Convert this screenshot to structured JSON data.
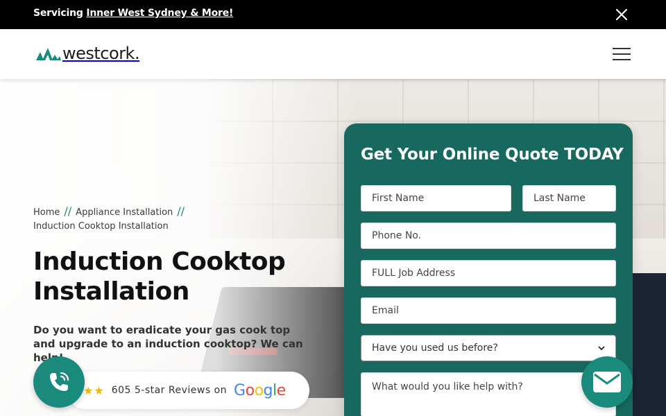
{
  "topbar": {
    "prefix": "Servicing ",
    "link_text": "Inner West Sydney & More!"
  },
  "header": {
    "logo_text": "westcork."
  },
  "breadcrumb": {
    "items": [
      "Home",
      "Appliance Installation",
      "Induction Cooktop Installation"
    ],
    "separator": "//"
  },
  "hero": {
    "title": "Induction Cooktop Installation",
    "lede": "Do you want to eradicate your gas cook top and upgrade to an induction cooktop? We can help!"
  },
  "reviews": {
    "stars": "★★",
    "text": "605 5-star Reviews on",
    "google_letters": [
      "G",
      "o",
      "o",
      "g",
      "l",
      "e"
    ]
  },
  "quote_form": {
    "heading": "Get Your Online Quote TODAY",
    "first_name_placeholder": "First Name",
    "last_name_placeholder": "Last Name",
    "phone_placeholder": "Phone No.",
    "address_placeholder": "FULL Job Address",
    "email_placeholder": "Email",
    "used_before_selected": "Have you used us before?",
    "help_placeholder": "What would you like help with?"
  },
  "colors": {
    "brand_teal": "#1a8a7d",
    "form_bg": "#17695f",
    "topbar_bg": "#000000",
    "google": [
      "#4285F4",
      "#EA4335",
      "#FBBC05",
      "#4285F4",
      "#34A853",
      "#EA4335"
    ]
  },
  "icons": {
    "close": "close-icon",
    "menu": "hamburger-menu-icon",
    "phone": "phone-icon",
    "mail": "mail-icon",
    "chevron": "chevron-down-icon"
  }
}
